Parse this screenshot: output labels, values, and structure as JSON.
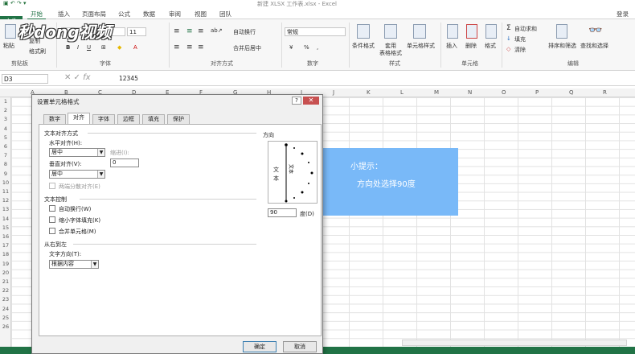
{
  "window": {
    "title": "新建 XLSX 工作表.xlsx - Excel",
    "login": "登录"
  },
  "tabs": {
    "file": "文件",
    "items": [
      "开始",
      "插入",
      "页面布局",
      "公式",
      "数据",
      "审阅",
      "视图",
      "团队"
    ]
  },
  "ribbon": {
    "clipboard": {
      "paste": "粘贴",
      "copy": "复制",
      "format_painter": "格式刷",
      "label": "剪贴板"
    },
    "font": {
      "size": "11",
      "label": "字体"
    },
    "alignment": {
      "wrap": "自动换行",
      "merge": "合并后居中",
      "label": "对齐方式"
    },
    "number": {
      "format": "常规",
      "label": "数字",
      "percent": "%",
      "comma": ","
    },
    "styles": {
      "conditional": "条件格式",
      "table_1": "套用",
      "table_2": "表格格式",
      "cell_styles": "单元格样式",
      "label": "样式"
    },
    "cells": {
      "insert": "插入",
      "delete": "删除",
      "format": "格式",
      "label": "单元格"
    },
    "editing": {
      "autosum": "自动求和",
      "fill": "填充",
      "clear": "清除",
      "sort": "排序和筛选",
      "find": "查找和选择",
      "label": "编辑"
    },
    "watermark": "秒dong视频"
  },
  "formula_bar": {
    "name_box": "D3",
    "content": "12345"
  },
  "columns": [
    "A",
    "B",
    "C",
    "D",
    "E",
    "F",
    "G",
    "H",
    "I",
    "J",
    "K",
    "L",
    "M",
    "N",
    "O",
    "P",
    "Q",
    "R"
  ],
  "rows": [
    "1",
    "2",
    "3",
    "4",
    "5",
    "6",
    "7",
    "8",
    "9",
    "10",
    "11",
    "12",
    "13",
    "14",
    "15",
    "16",
    "17",
    "18",
    "19",
    "20",
    "21",
    "22",
    "23",
    "24",
    "25",
    "26"
  ],
  "tip": {
    "title": "小提示：",
    "body": "方向处选择90度"
  },
  "dialog": {
    "title": "设置单元格格式",
    "help": "?",
    "close": "✕",
    "tabs": [
      "数字",
      "对齐",
      "字体",
      "边框",
      "填充",
      "保护"
    ],
    "text_alignment": "文本对齐方式",
    "h_align_label": "水平对齐(H):",
    "h_align_value": "居中",
    "indent_label": "缩进(I):",
    "indent_value": "0",
    "v_align_label": "垂直对齐(V):",
    "v_align_value": "居中",
    "distributed": "两端分散对齐(E)",
    "text_control": "文本控制",
    "wrap_text": "自动换行(W)",
    "shrink": "缩小字体填充(K)",
    "merge": "合并单元格(M)",
    "rtl": "从右到左",
    "direction_label": "文字方向(T):",
    "direction_value": "根据内容",
    "orientation": "方向",
    "vertical_text": "文本",
    "rotated_text": "文本",
    "degrees_value": "90",
    "degrees_label": "度(D)",
    "ok": "确定",
    "cancel": "取消"
  }
}
